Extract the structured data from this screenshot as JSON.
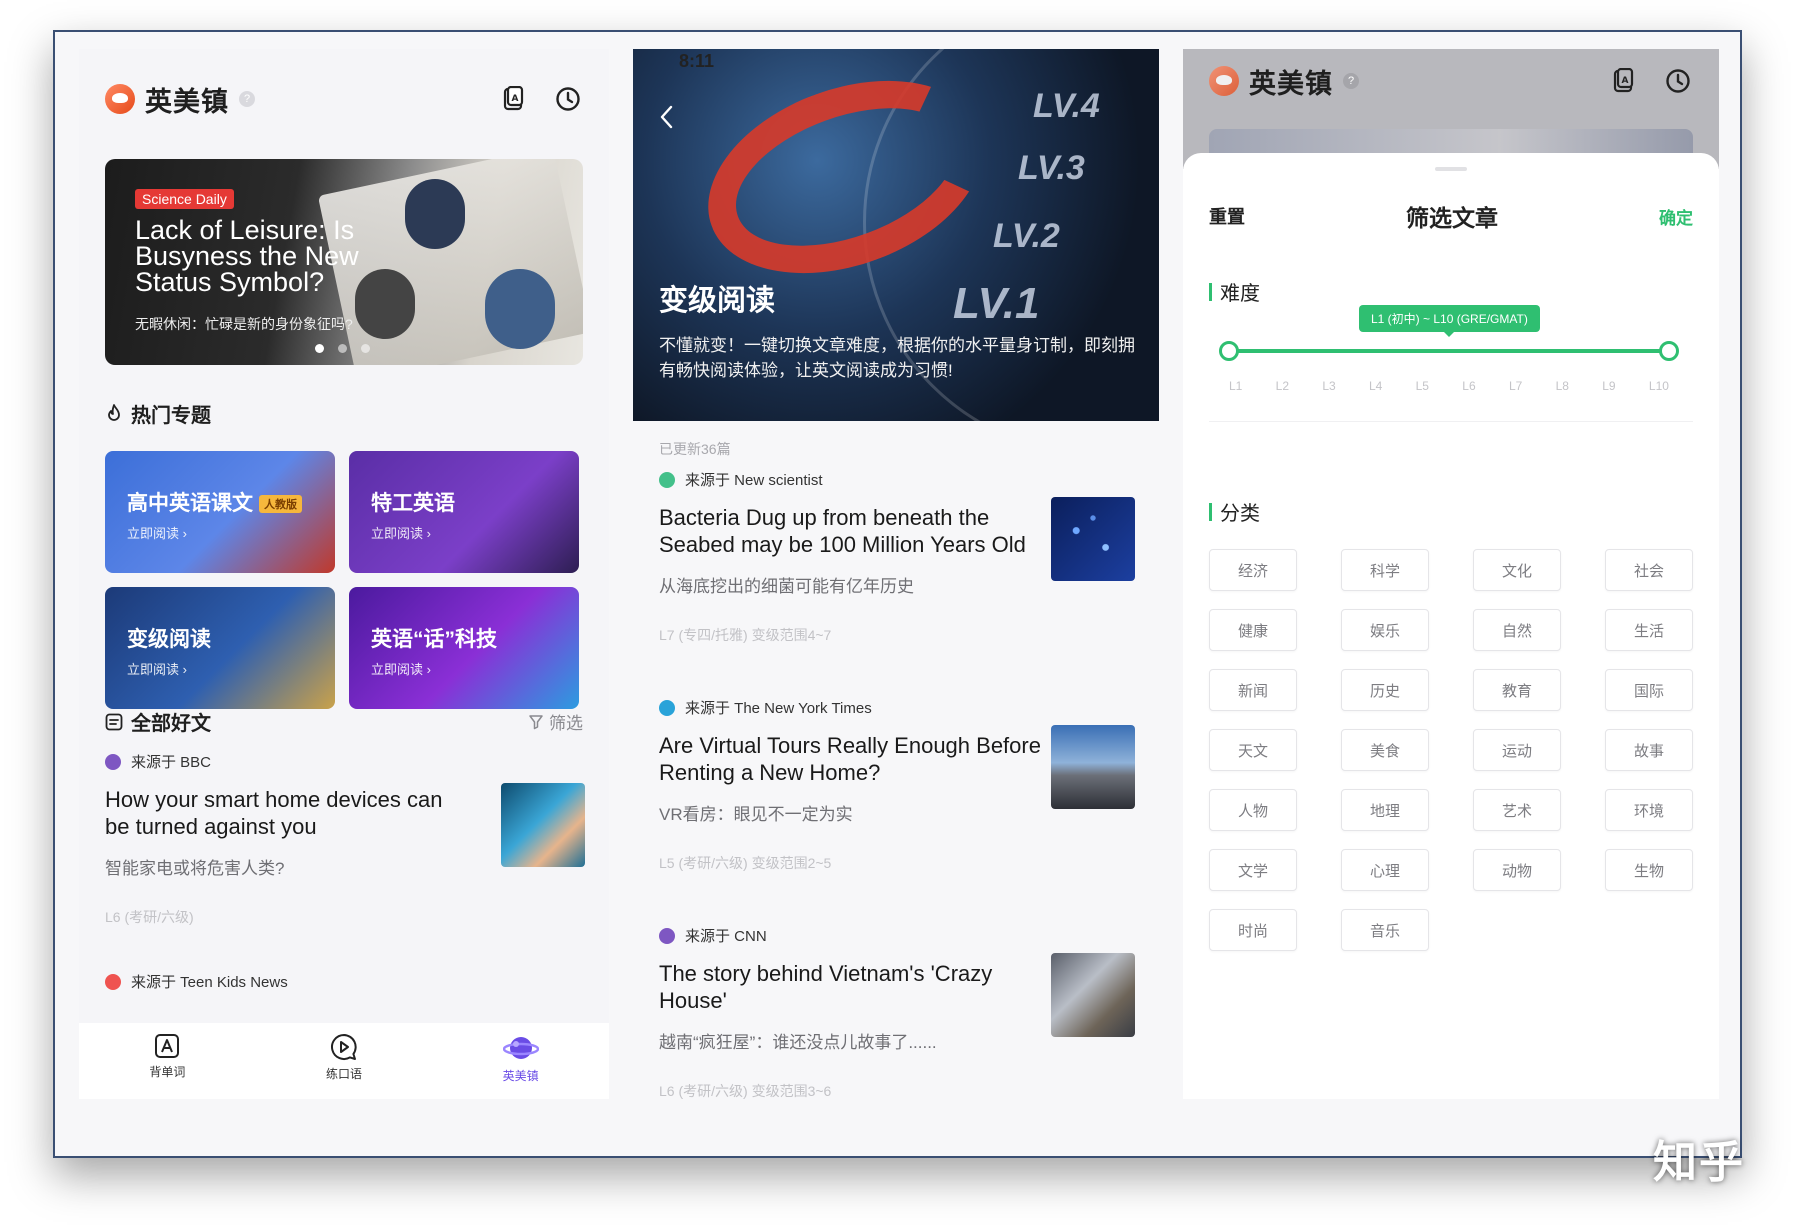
{
  "app": {
    "title": "英美镇",
    "help": "?"
  },
  "banner": {
    "tag": "Science Daily",
    "title": "Lack of Leisure: Is Busyness the New Status Symbol?",
    "subtitle": "无暇休闲：忙碌是新的身份象征吗?"
  },
  "hot_topics": {
    "title": "热门专题",
    "items": [
      {
        "title": "高中英语课文",
        "badge": "人教版",
        "action": "立即阅读 ›"
      },
      {
        "title": "特工英语",
        "action": "立即阅读 ›"
      },
      {
        "title": "变级阅读",
        "action": "立即阅读 ›"
      },
      {
        "title": "英语“话”科技",
        "action": "立即阅读 ›"
      }
    ]
  },
  "all_articles": {
    "title": "全部好文",
    "filter": "筛选",
    "items": [
      {
        "source": "来源于 BBC",
        "title": "How your smart home devices can be turned against you",
        "subtitle": "智能家电或将危害人类?",
        "meta": "L6 (考研/六级)"
      },
      {
        "source": "来源于 Teen Kids News"
      }
    ]
  },
  "nav": {
    "items": [
      "背单词",
      "练口语",
      "英美镇"
    ],
    "active": "英美镇"
  },
  "graded": {
    "status_time": "8:11",
    "title": "变级阅读",
    "description": "不懂就变！一键切换文章难度，根据你的水平量身订制，即刻拥有畅快阅读体验，让英文阅读成为习惯!",
    "updated": "已更新36篇",
    "levels": [
      "LV.4",
      "LV.3",
      "LV.2",
      "LV.1"
    ],
    "articles": [
      {
        "source": "来源于 New scientist",
        "title": "Bacteria Dug up from beneath the Seabed may be 100 Million Years Old",
        "subtitle": "从海底挖出的细菌可能有亿年历史",
        "meta": "L7 (专四/托雅)  变级范围4~7"
      },
      {
        "source": "来源于 The New York Times",
        "title": "Are Virtual Tours Really Enough Before Renting a New Home?",
        "subtitle": "VR看房：眼见不一定为实",
        "meta": "L5 (考研/六级)  变级范围2~5"
      },
      {
        "source": "来源于 CNN",
        "title": "The story behind Vietnam's 'Crazy House'",
        "subtitle": "越南“疯狂屋”：谁还没点儿故事了......",
        "meta": "L6 (考研/六级)  变级范围3~6"
      }
    ]
  },
  "filter_sheet": {
    "reset": "重置",
    "title": "筛选文章",
    "confirm": "确定",
    "difficulty_label": "难度",
    "range_label": "L1 (初中) ~ L10 (GRE/GMAT)",
    "range": [
      1,
      10
    ],
    "ticks": [
      "L1",
      "L2",
      "L3",
      "L4",
      "L5",
      "L6",
      "L7",
      "L8",
      "L9",
      "L10"
    ],
    "category_label": "分类",
    "categories": [
      "经济",
      "科学",
      "文化",
      "社会",
      "健康",
      "娱乐",
      "自然",
      "生活",
      "新闻",
      "历史",
      "教育",
      "国际",
      "天文",
      "美食",
      "运动",
      "故事",
      "人物",
      "地理",
      "艺术",
      "环境",
      "文学",
      "心理",
      "动物",
      "生物",
      "时尚",
      "音乐"
    ]
  },
  "watermark": "知乎",
  "colors": {
    "accent_green": "#2fbf71",
    "accent_purple": "#6a4ce6",
    "alert_red": "#e53935"
  }
}
